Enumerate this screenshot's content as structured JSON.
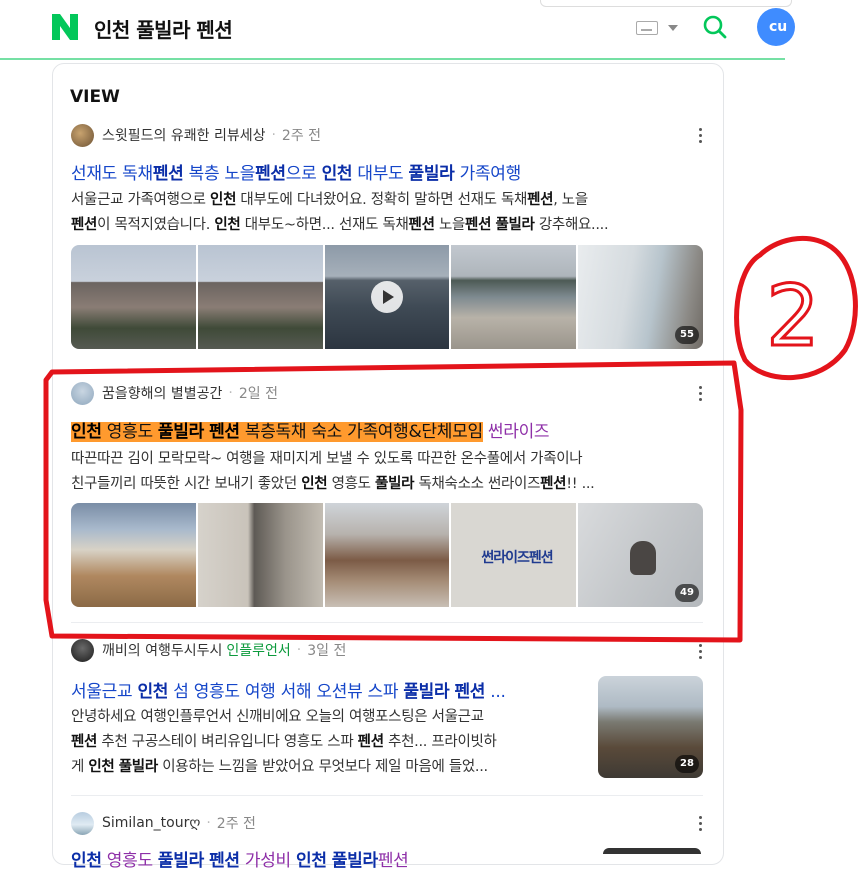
{
  "header": {
    "query": "인천 풀빌라 펜션",
    "avatar_text": "ㅇㅇ"
  },
  "section": {
    "title": "VIEW"
  },
  "posts": [
    {
      "author": "스윗필드의 유쾌한 리뷰세상",
      "time": "2주 전",
      "title_parts": [
        "선재도 독채",
        "펜션",
        " 복층 노을",
        "펜션",
        "으로 ",
        "인천",
        " 대부도 ",
        "풀빌라",
        " 가족여행"
      ],
      "desc_lines": [
        [
          "서울근교 가족여행으로 ",
          "인천",
          " 대부도에 다녀왔어요. 정확히 말하면 선재도 독채",
          "펜션",
          ", 노을"
        ],
        [
          "펜션",
          "이 목적지였습니다. ",
          "인천",
          " 대부도~하면... 선재도 독채",
          "펜션",
          " 노을",
          "펜션",
          " ",
          "풀빌라",
          " 강추해요...."
        ]
      ],
      "badge": "55"
    },
    {
      "author": "꿈을향해의 별별공간",
      "time": "2일 전",
      "title_parts": [
        "인천",
        " 영흥도 ",
        "풀빌라",
        " ",
        "펜션",
        " 복층독채 숙소 가족여행&단체모임"
      ],
      "title_extra": "썬라이즈",
      "desc_lines": [
        [
          "따끈따끈 김이 모락모락~ 여행을 재미지게 보낼 수 있도록 따끈한 온수풀에서 가족이나"
        ],
        [
          "친구들끼리 따뜻한 시간 보내기 좋았던 ",
          "인천",
          " 영흥도 ",
          "풀빌라",
          " 독채숙소소 썬라이즈",
          "펜션",
          "!! ..."
        ]
      ],
      "sign_text": "썬라이즈펜션",
      "badge": "49"
    },
    {
      "author": "깨비의 여행두시두시",
      "sub": "인플루언서",
      "time": "3일 전",
      "title_parts": [
        "서울근교 ",
        "인천",
        " 섬 영흥도 여행 서해 오션뷰 스파 ",
        "풀빌라",
        " ",
        "펜션",
        " ..."
      ],
      "desc_lines": [
        [
          "안녕하세요 여행인플루언서 신깨비에요 오늘의 여행포스팅은 서울근교"
        ],
        [
          "펜션",
          " 추천 구공스테이 벼리유입니다 영흥도 스파 ",
          "펜션",
          " 추천... 프라이빗하"
        ],
        [
          "게 ",
          "인천",
          " ",
          "풀빌라",
          " 이용하는 느낌을 받았어요 무엇보다 제일 마음에 들었..."
        ]
      ],
      "badge": "28"
    },
    {
      "author": "Similan_tourღ",
      "time": "2주 전",
      "title_parts": [
        "인천",
        " 영흥도 ",
        "풀빌라",
        " ",
        "펜션",
        " 가성비 ",
        "인천",
        " ",
        "풀빌라",
        "펜션"
      ]
    }
  ],
  "annotation": {
    "label": "2",
    "color": "#e3141b"
  },
  "colors": {
    "accent": "#03c75a",
    "link": "#1546c9",
    "highlight": "#ff9a2e"
  }
}
